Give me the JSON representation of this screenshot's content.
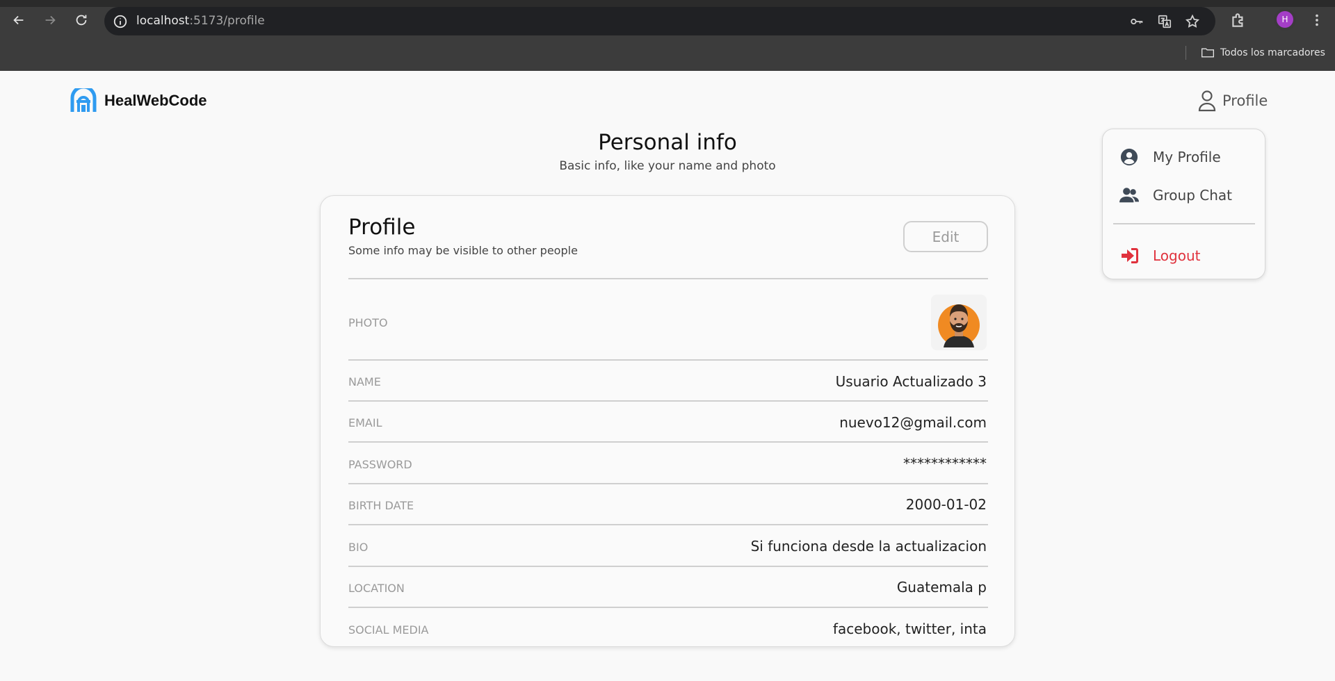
{
  "browser": {
    "url_host": "localhost",
    "url_path": ":5173/profile",
    "profile_initial": "H",
    "bookmarks_label": "Todos los marcadores"
  },
  "app": {
    "brand": "HealWebCode",
    "profile_label": "Profile",
    "colors": {
      "brand_blue": "#2f9bf0",
      "logout_red": "#e0323d"
    }
  },
  "dropdown": {
    "items": [
      {
        "label": "My Profile",
        "icon": "user-circle-icon"
      },
      {
        "label": "Group Chat",
        "icon": "users-icon"
      }
    ],
    "logout_label": "Logout"
  },
  "header": {
    "title": "Personal info",
    "subtitle": "Basic info, like your name and photo"
  },
  "card": {
    "title": "Profile",
    "subtitle": "Some info may be visible to other people",
    "edit_label": "Edit",
    "photo_label": "PHOTO",
    "rows": [
      {
        "label": "NAME",
        "value": "Usuario Actualizado 3"
      },
      {
        "label": "EMAIL",
        "value": "nuevo12@gmail.com"
      },
      {
        "label": "PASSWORD",
        "value": "************"
      },
      {
        "label": "BIRTH DATE",
        "value": "2000-01-02"
      },
      {
        "label": "BIO",
        "value": "Si funciona desde la actualizacion"
      },
      {
        "label": "LOCATION",
        "value": "Guatemala p"
      },
      {
        "label": "SOCIAL MEDIA",
        "value": "facebook, twitter, inta"
      }
    ]
  }
}
